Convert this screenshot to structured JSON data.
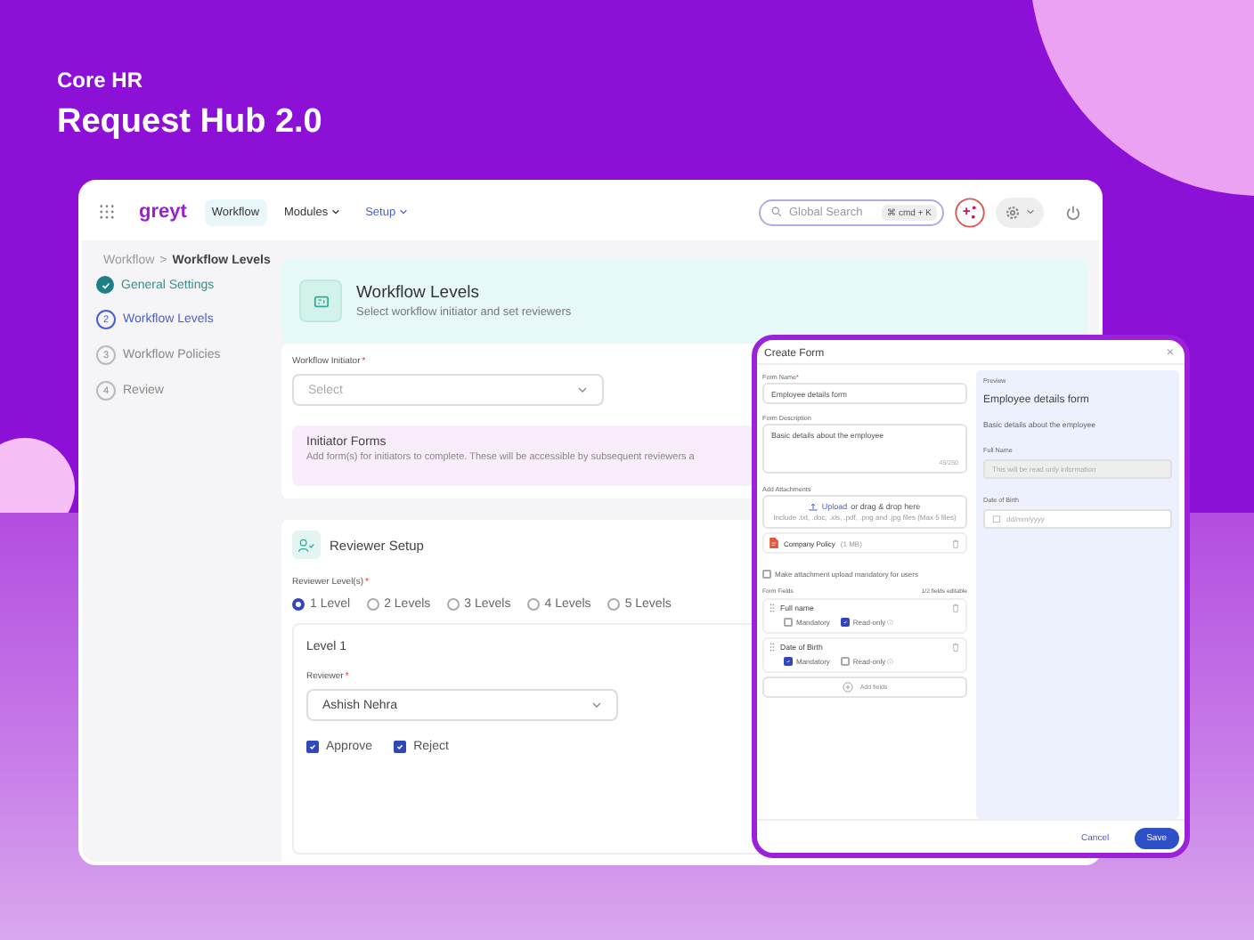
{
  "header": {
    "eyebrow": "Core HR",
    "title": "Request Hub 2.0"
  },
  "app": {
    "nav": {
      "logo": "greyt",
      "items": [
        {
          "label": "Workflow",
          "selected": true,
          "kind": "plain"
        },
        {
          "label": "Modules",
          "selected": false,
          "kind": "menu"
        },
        {
          "label": "Setup",
          "selected": false,
          "kind": "link"
        }
      ],
      "search": {
        "placeholder": "Global Search",
        "shortcut": "⌘ cmd + K"
      }
    },
    "breadcrumb": {
      "items": [
        "Workflow",
        "Workflow Levels"
      ],
      "separator": ">"
    },
    "steps": [
      {
        "label": "General Settings",
        "completed": true,
        "selected": false
      },
      {
        "number": "2",
        "label": "Workflow Levels",
        "completed": false,
        "selected": true
      },
      {
        "number": "3",
        "label": "Workflow Policies",
        "completed": false,
        "selected": false
      },
      {
        "number": "4",
        "label": "Review",
        "completed": false,
        "selected": false
      }
    ],
    "section": {
      "title": "Workflow Levels",
      "subtitle": "Select workflow initiator and set reviewers"
    },
    "initiator": {
      "label": "Workflow Initiator",
      "required_mark": "*",
      "placeholder": "Select"
    },
    "initiator_forms": {
      "title": "Initiator Forms",
      "text": "Add form(s) for initiators to complete. These will be accessible by subsequent reviewers a"
    },
    "reviewer_setup": {
      "title": "Reviewer Setup",
      "levels_label": "Reviewer Level(s)",
      "required_mark": "*",
      "options": [
        {
          "label": "1 Level",
          "selected": true
        },
        {
          "label": "2 Levels",
          "selected": false
        },
        {
          "label": "3 Levels",
          "selected": false
        },
        {
          "label": "4 Levels",
          "selected": false
        },
        {
          "label": "5 Levels",
          "selected": false
        }
      ],
      "level_card": {
        "title": "Level 1",
        "reviewer_label": "Reviewer",
        "required_mark": "*",
        "reviewer_value": "Ashish Nehra",
        "actions": [
          {
            "label": "Approve",
            "checked": true
          },
          {
            "label": "Reject",
            "checked": true
          }
        ]
      }
    }
  },
  "dialog": {
    "title": "Create Form",
    "close": "×",
    "form_name": {
      "label": "Form Name",
      "required_mark": "*",
      "value": "Employee details form"
    },
    "description": {
      "label": "Form Description",
      "value": "Basic details about the employee",
      "counter": "45/250"
    },
    "attachments": {
      "label": "Add Attachments",
      "upload_link": "Upload",
      "upload_text": "or drag & drop here",
      "hint": "Include .txt, .doc, .xls, .pdf, .png and .jpg files (Max 5 files)",
      "files": [
        {
          "name": "Company Policy",
          "size": "(1 MB)"
        }
      ]
    },
    "mandatory_upload": {
      "label": "Make attachment upload mandatory for users",
      "checked": false
    },
    "fields_label": "Form Fields",
    "fields_count": "1/2 fields editable",
    "fields": [
      {
        "name": "Full name",
        "mandatory_label": "Mandatory",
        "mandatory": false,
        "readonly_label": "Read-only",
        "read_only": true
      },
      {
        "name": "Date of Birth",
        "mandatory_label": "Mandatory",
        "mandatory": true,
        "readonly_label": "Read-only",
        "read_only": false
      }
    ],
    "add_fields": "Add fields",
    "preview": {
      "label": "Preview",
      "title": "Employee details form",
      "description": "Basic details about the employee",
      "fields": [
        {
          "label": "Full Name",
          "placeholder": "This will be read only information",
          "kind": "readonly"
        },
        {
          "label": "Date of Birth",
          "placeholder": "dd/mm/yyyy",
          "kind": "date"
        }
      ]
    },
    "footer": {
      "cancel": "Cancel",
      "save": "Save"
    }
  }
}
